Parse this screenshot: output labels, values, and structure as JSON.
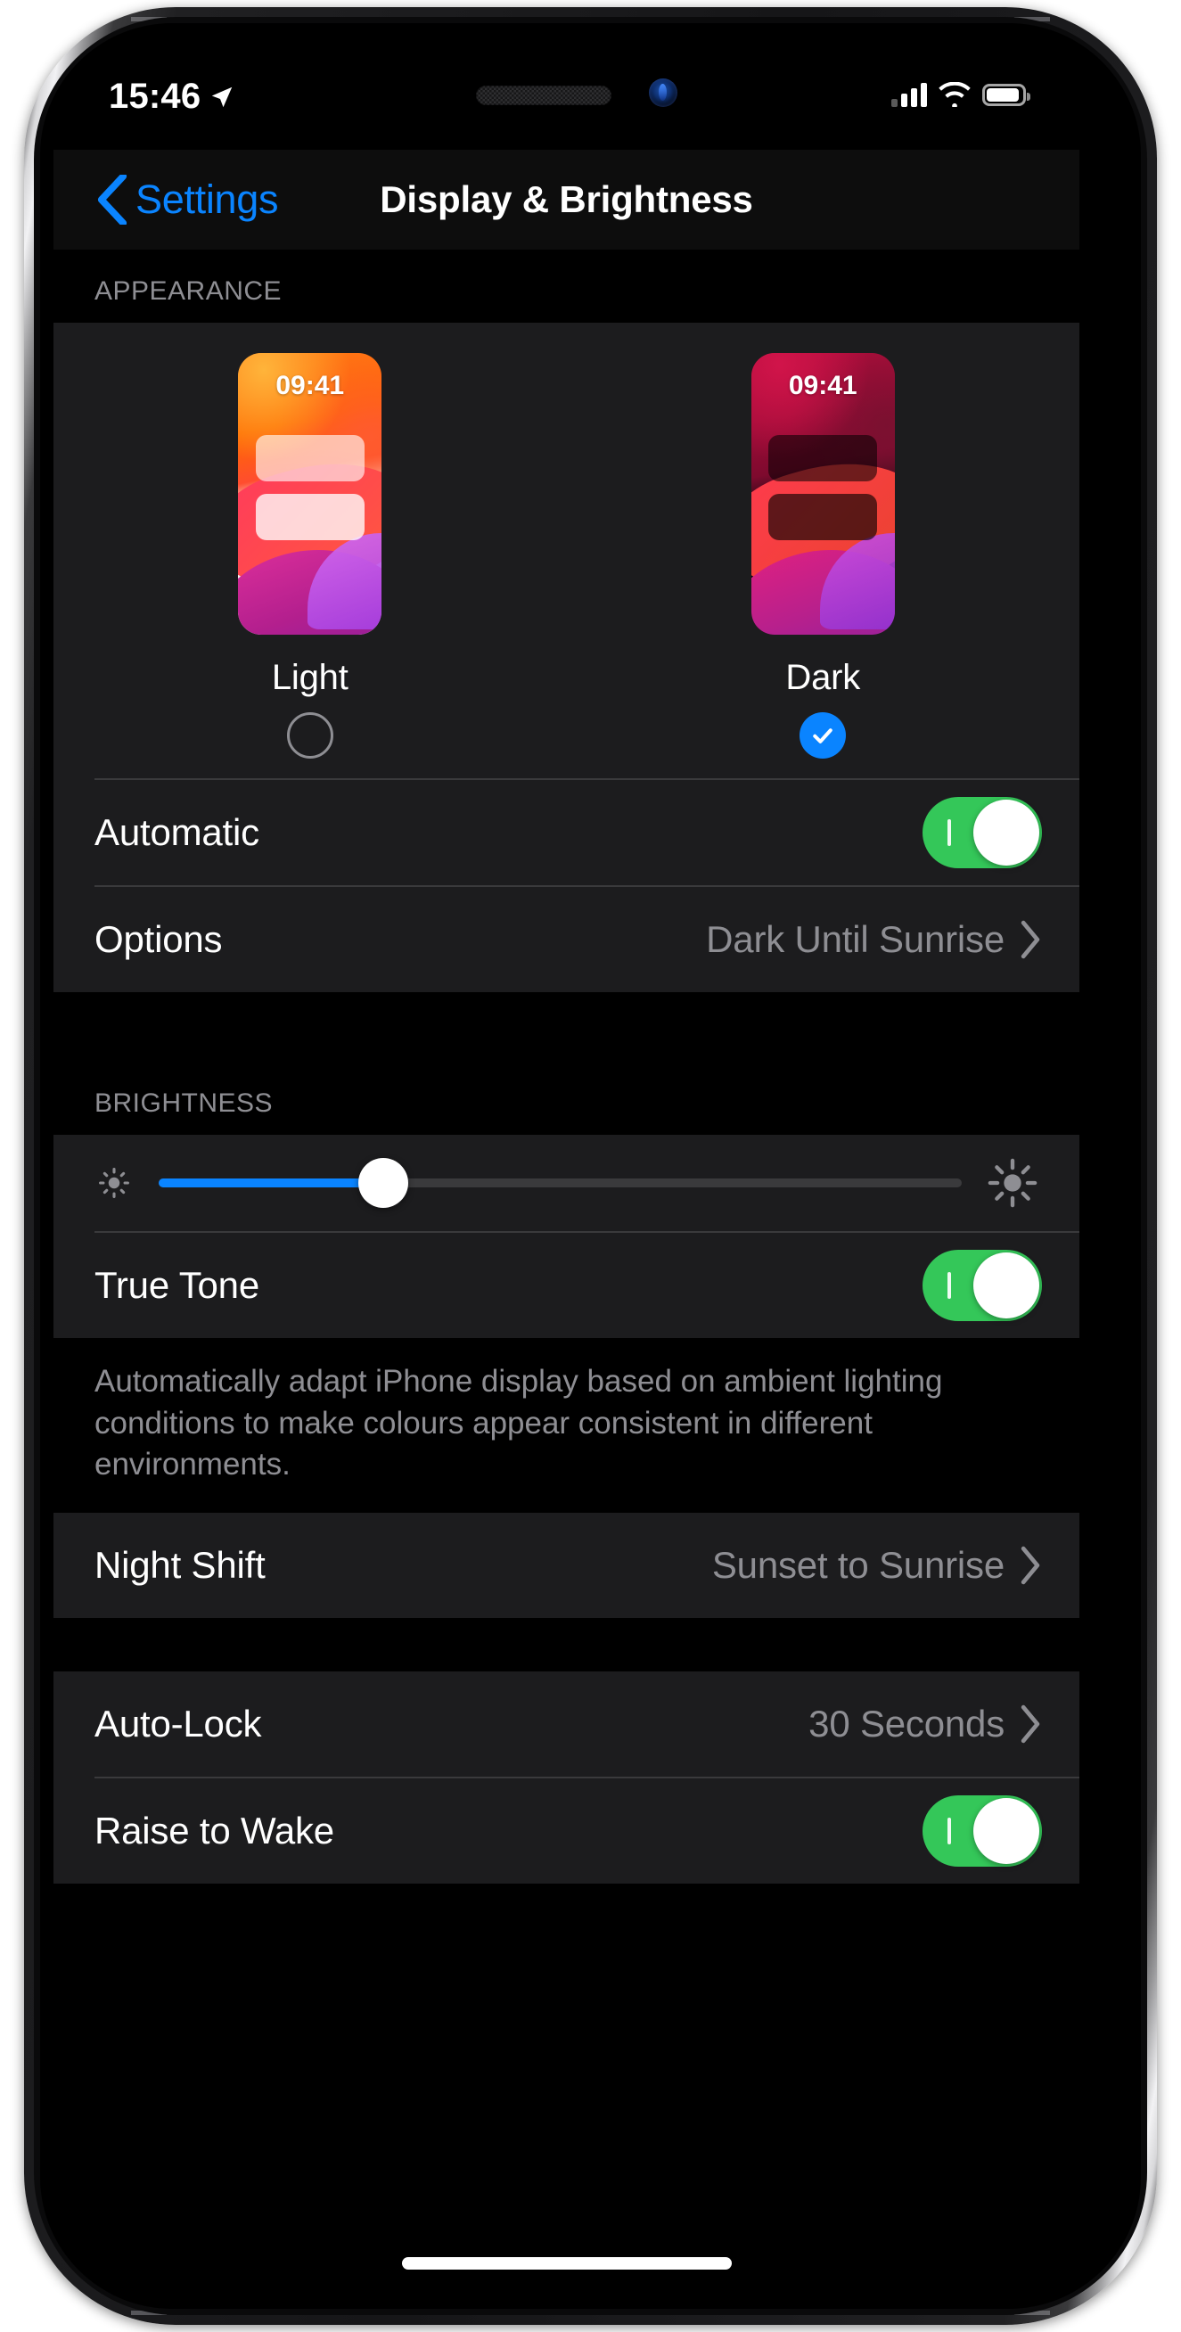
{
  "status_bar": {
    "time": "15:46",
    "location_icon": "location-arrow-icon",
    "signal_icon": "cellular-signal-icon",
    "wifi_icon": "wifi-icon",
    "battery_icon": "battery-icon"
  },
  "nav": {
    "back_label": "Settings",
    "back_icon": "chevron-left-icon",
    "title": "Display & Brightness"
  },
  "appearance": {
    "header": "APPEARANCE",
    "modes": [
      {
        "label": "Light",
        "clock": "09:41",
        "selected": false
      },
      {
        "label": "Dark",
        "clock": "09:41",
        "selected": true
      }
    ],
    "automatic": {
      "label": "Automatic",
      "toggle_on": true
    },
    "options": {
      "label": "Options",
      "value": "Dark Until Sunrise",
      "chevron": "chevron-right-icon"
    }
  },
  "brightness": {
    "header": "BRIGHTNESS",
    "low_icon": "brightness-low-icon",
    "high_icon": "brightness-high-icon",
    "value_percent": 28,
    "true_tone": {
      "label": "True Tone",
      "toggle_on": true
    },
    "footnote": "Automatically adapt iPhone display based on ambient lighting conditions to make colours appear consistent in different environments."
  },
  "night_shift": {
    "label": "Night Shift",
    "value": "Sunset to Sunrise",
    "chevron": "chevron-right-icon"
  },
  "lock_group": {
    "auto_lock": {
      "label": "Auto-Lock",
      "value": "30 Seconds",
      "chevron": "chevron-right-icon"
    },
    "raise_to_wake": {
      "label": "Raise to Wake",
      "toggle_on": true
    }
  },
  "colors": {
    "accent_blue": "#0a84ff",
    "toggle_green": "#34c759",
    "group_bg": "#1c1c1e",
    "page_bg": "#000000",
    "secondary_text": "#8e8e93"
  }
}
